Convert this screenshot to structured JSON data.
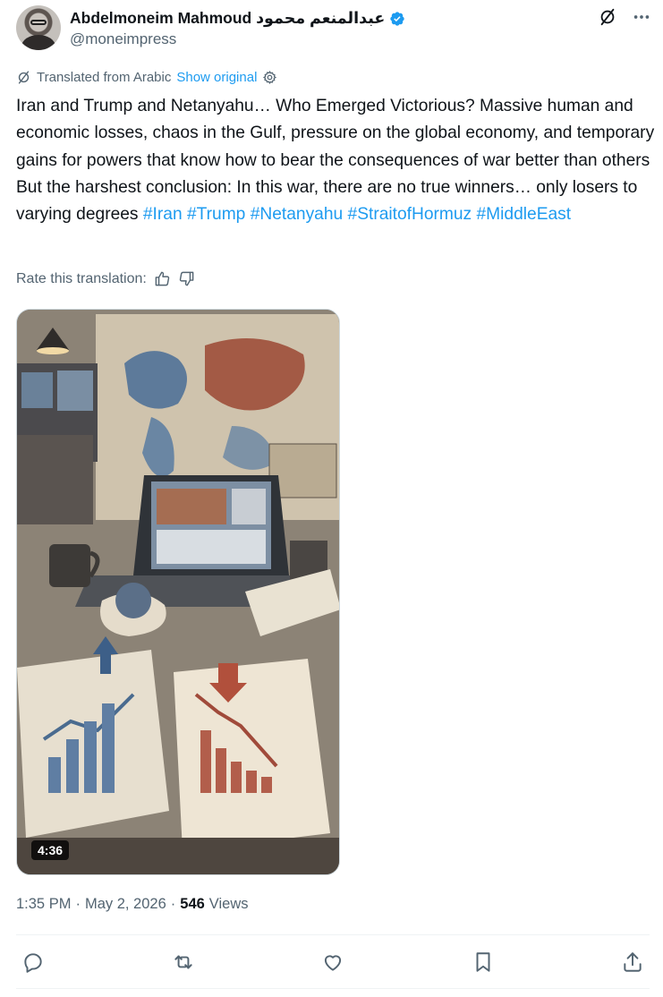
{
  "author": {
    "name": "Abdelmoneim Mahmoud عبدالمنعم محمود",
    "handle": "@moneimpress",
    "verified": true
  },
  "translation": {
    "label": "Translated from Arabic",
    "show_original": "Show original"
  },
  "tweet": {
    "text": "Iran and Trump and Netanyahu… Who Emerged Victorious? Massive human and economic losses, chaos in the Gulf, pressure on the global economy, and temporary gains for powers that know how to bear the consequences of war better than others But the harshest conclusion: In this war, there are no true winners… only losers to varying degrees",
    "hashtags": [
      "#Iran",
      "#Trump",
      "#Netanyahu",
      "#StraitofHormuz",
      "#MiddleEast"
    ]
  },
  "rate": {
    "label": "Rate this translation:"
  },
  "media": {
    "type": "video",
    "duration": "4:36"
  },
  "meta": {
    "time": "1:35 PM",
    "sep1": "·",
    "date": "May 2, 2026",
    "sep2": "·",
    "views_count": "546",
    "views_label": "Views"
  },
  "colors": {
    "accent": "#1d9bf0",
    "secondary_text": "#536471",
    "primary_text": "#0f1419"
  },
  "icons": {
    "grok": "grok-icon",
    "more": "more-icon",
    "reply": "reply-icon",
    "retweet": "retweet-icon",
    "like": "like-icon",
    "bookmark": "bookmark-icon",
    "share": "share-icon"
  }
}
